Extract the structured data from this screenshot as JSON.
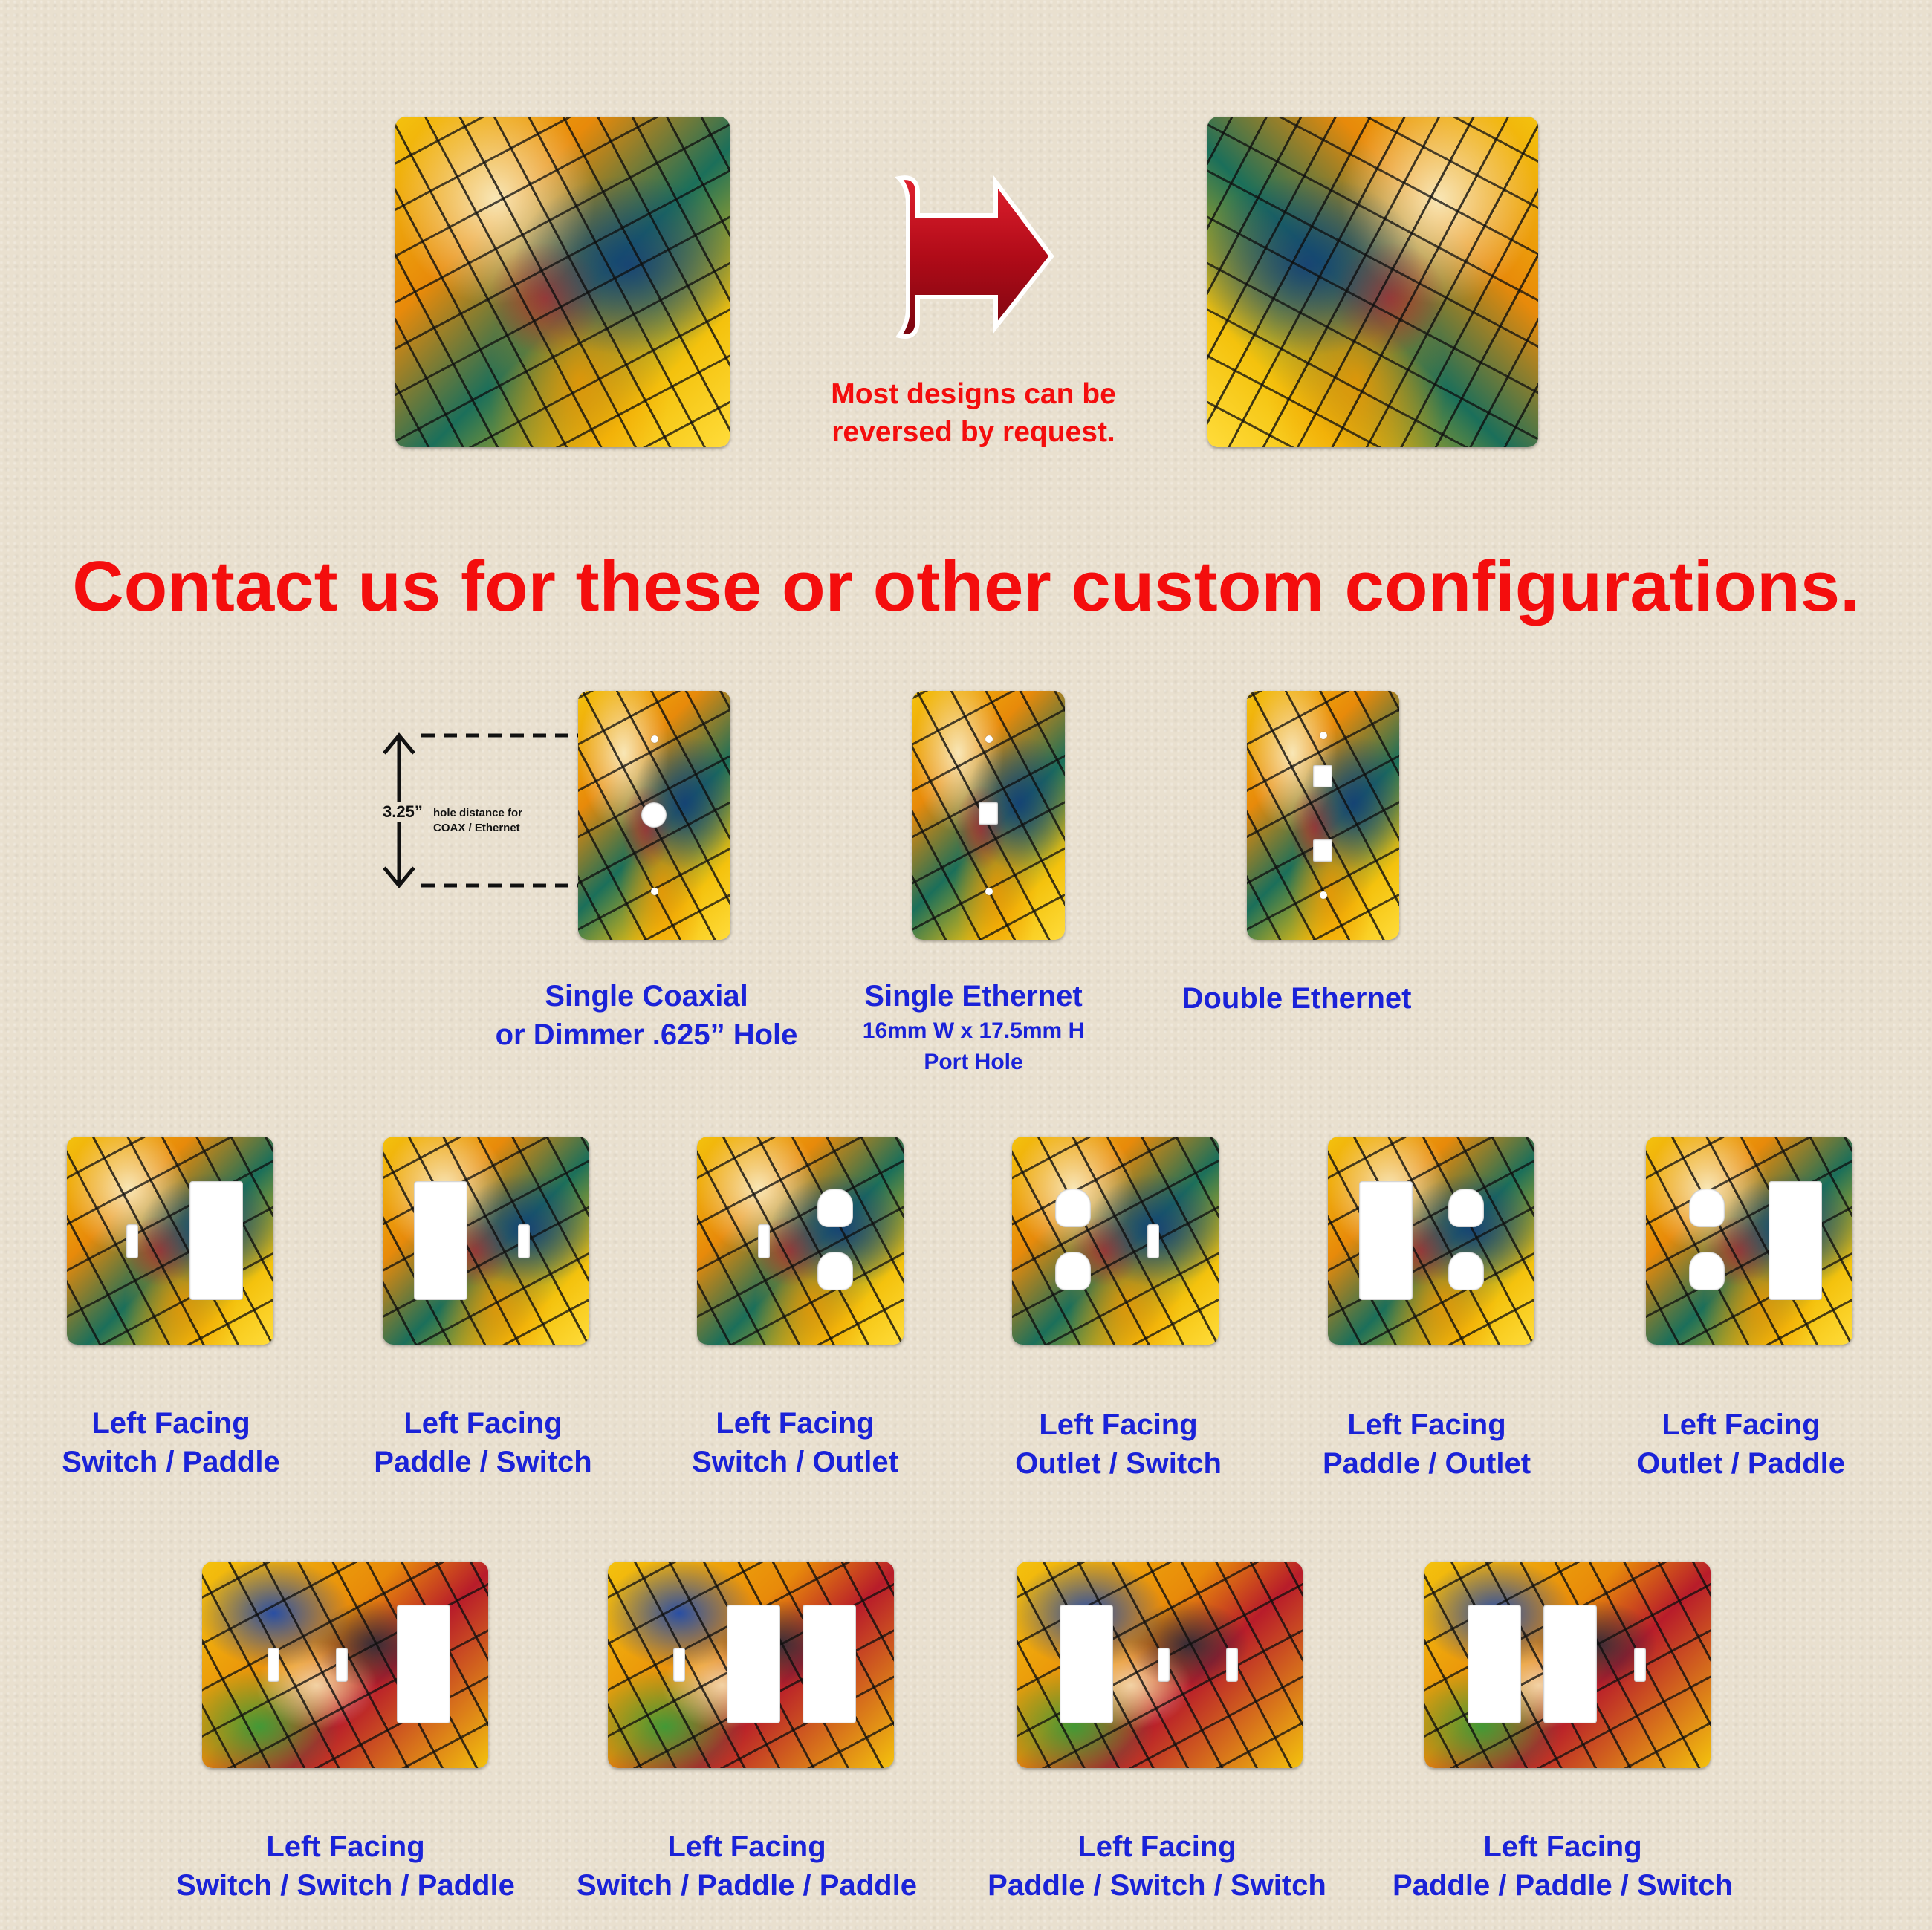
{
  "header": {
    "reverse_note_line1": "Most designs can be",
    "reverse_note_line2": "reversed by request.",
    "headline": "Contact us for these or other custom configurations."
  },
  "colors": {
    "headline": "#f40d0d",
    "labels": "#1a22d8",
    "arrow": "#c4101e",
    "background": "#e9e0cf"
  },
  "dimension_callout": {
    "value": "3.25”",
    "text_line1": "hole distance for",
    "text_line2": "COAX / Ethernet"
  },
  "row1": [
    {
      "line1": "Single Coaxial",
      "line2": "or Dimmer .625” Hole"
    },
    {
      "line1": "Single Ethernet",
      "line2": "16mm W x 17.5mm H",
      "line3": "Port Hole"
    },
    {
      "line1": "Double Ethernet"
    }
  ],
  "row2": [
    {
      "line1": "Left Facing",
      "line2": "Switch / Paddle"
    },
    {
      "line1": "Left Facing",
      "line2": "Paddle / Switch"
    },
    {
      "line1": "Left Facing",
      "line2": "Switch / Outlet"
    },
    {
      "line1": "Left Facing",
      "line2": "Outlet / Switch"
    },
    {
      "line1": "Left Facing",
      "line2": "Paddle / Outlet"
    },
    {
      "line1": "Left Facing",
      "line2": "Outlet / Paddle"
    }
  ],
  "row3": [
    {
      "line1": "Left Facing",
      "line2": "Switch / Switch / Paddle"
    },
    {
      "line1": "Left Facing",
      "line2": "Switch / Paddle / Paddle"
    },
    {
      "line1": "Left Facing",
      "line2": "Paddle / Switch / Switch"
    },
    {
      "line1": "Left Facing",
      "line2": "Paddle / Paddle / Switch"
    }
  ]
}
